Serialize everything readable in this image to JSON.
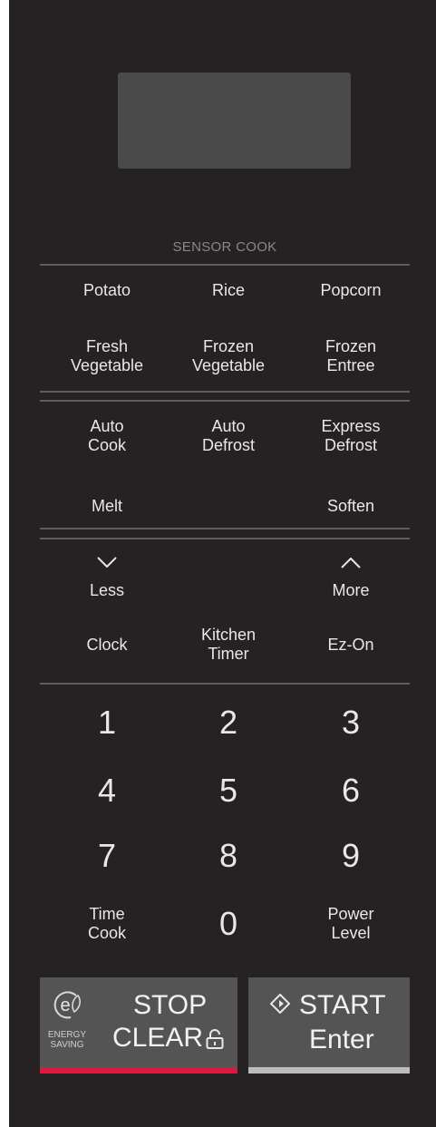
{
  "sensor_cook": {
    "title": "SENSOR COOK",
    "potato": "Potato",
    "rice": "Rice",
    "popcorn": "Popcorn",
    "fresh_vegetable": [
      "Fresh",
      "Vegetable"
    ],
    "frozen_vegetable": [
      "Frozen",
      "Vegetable"
    ],
    "frozen_entree": [
      "Frozen",
      "Entree"
    ]
  },
  "programs": {
    "auto_cook": [
      "Auto",
      "Cook"
    ],
    "auto_defrost": [
      "Auto",
      "Defrost"
    ],
    "express_defrost": [
      "Express",
      "Defrost"
    ],
    "melt": "Melt",
    "soften": "Soften"
  },
  "adjust": {
    "less": "Less",
    "more": "More",
    "clock": "Clock",
    "kitchen_timer": [
      "Kitchen",
      "Timer"
    ],
    "ez_on": "Ez-On"
  },
  "keypad": {
    "digits": [
      "1",
      "2",
      "3",
      "4",
      "5",
      "6",
      "7",
      "8",
      "9",
      "0"
    ],
    "time_cook": [
      "Time",
      "Cook"
    ],
    "power_level": [
      "Power",
      "Level"
    ]
  },
  "stop_clear": {
    "stop": "STOP",
    "clear": "CLEAR",
    "energy": [
      "ENERGY",
      "SAVING"
    ],
    "energy_icon_letter": "e",
    "bar_color": "#e3163f"
  },
  "start": {
    "start": "START",
    "enter": "Enter",
    "bar_color": "#bcbcbc"
  },
  "icons": [
    "chevron-down-icon",
    "chevron-up-icon",
    "energy-leaf-icon",
    "lock-icon",
    "start-diamond-icon"
  ]
}
